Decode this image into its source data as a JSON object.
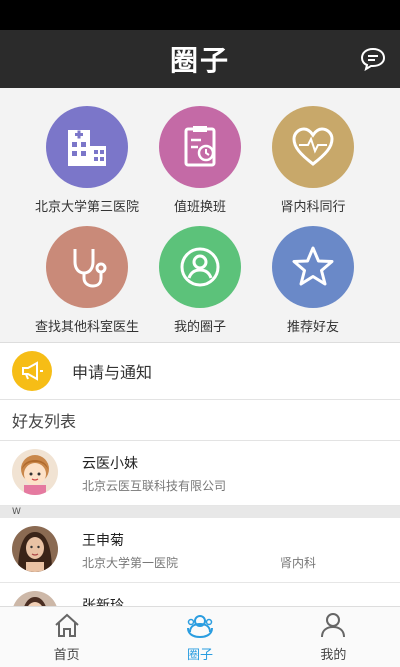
{
  "header": {
    "title": "圈子",
    "message_icon": "chat-bubble-icon"
  },
  "grid": [
    {
      "label": "北京大学第三医院",
      "icon": "hospital-icon",
      "color": "#7b76c9"
    },
    {
      "label": "值班换班",
      "icon": "clipboard-clock-icon",
      "color": "#c46aa6"
    },
    {
      "label": "肾内科同行",
      "icon": "heart-pulse-icon",
      "color": "#c8a86a"
    },
    {
      "label": "查找其他科室医生",
      "icon": "stethoscope-icon",
      "color": "#c98a79"
    },
    {
      "label": "我的圈子",
      "icon": "user-circle-icon",
      "color": "#5cc27a"
    },
    {
      "label": "推荐好友",
      "icon": "star-icon",
      "color": "#6a89c8"
    }
  ],
  "notice": {
    "label": "申请与通知",
    "icon": "megaphone-icon",
    "color": "#f6bd16"
  },
  "friends_title": "好友列表",
  "friends": [
    {
      "name": "云医小妹",
      "org": "北京云医互联科技有限公司",
      "dept": ""
    },
    {
      "section_letter": "W"
    },
    {
      "name": "王申菊",
      "org": "北京大学第一医院",
      "dept": "肾内科"
    },
    {
      "name": "张新玲",
      "org": "",
      "dept": ""
    }
  ],
  "tabs": [
    {
      "label": "首页",
      "icon": "home-icon",
      "active": false
    },
    {
      "label": "圈子",
      "icon": "circle-people-icon",
      "active": true
    },
    {
      "label": "我的",
      "icon": "person-icon",
      "active": false
    }
  ]
}
